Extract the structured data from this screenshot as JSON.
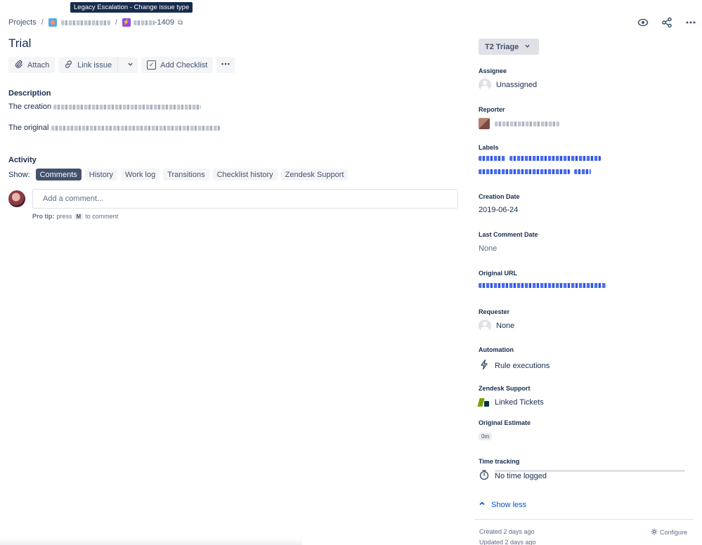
{
  "tooltip": "Legacy Escalation - Change issue type",
  "breadcrumbs": {
    "projects": "Projects",
    "sep": "/",
    "issue_key_suffix": "-1409"
  },
  "issue": {
    "title": "Trial"
  },
  "toolbar": {
    "attach": "Attach",
    "link_issue": "Link issue",
    "add_checklist": "Add Checklist"
  },
  "description": {
    "label": "Description",
    "line1_prefix": "The creation",
    "line2_prefix": "The original"
  },
  "activity": {
    "label": "Activity",
    "show_label": "Show:",
    "tabs": [
      "Comments",
      "History",
      "Work log",
      "Transitions",
      "Checklist history",
      "Zendesk Support"
    ],
    "comment_placeholder": "Add a comment...",
    "pro_tip_label": "Pro tip:",
    "pro_tip_press": "press",
    "pro_tip_key": "M",
    "pro_tip_rest": "to comment"
  },
  "sidebar": {
    "status": "T2 Triage",
    "assignee_label": "Assignee",
    "assignee_value": "Unassigned",
    "reporter_label": "Reporter",
    "labels_label": "Labels",
    "creation_date_label": "Creation Date",
    "creation_date_value": "2019-06-24",
    "last_comment_label": "Last Comment Date",
    "last_comment_value": "None",
    "original_url_label": "Original URL",
    "requester_label": "Requester",
    "requester_value": "None",
    "automation_label": "Automation",
    "automation_value": "Rule executions",
    "zendesk_label": "Zendesk Support",
    "zendesk_value": "Linked Tickets",
    "original_estimate_label": "Original Estimate",
    "original_estimate_value": "0m",
    "time_tracking_label": "Time tracking",
    "time_tracking_value": "No time logged",
    "show_less": "Show less"
  },
  "footer": {
    "created": "Created 2 days ago",
    "updated": "Updated 2 days ago",
    "configure": "Configure"
  },
  "colors": {
    "accent": "#0052cc",
    "text": "#172b4d",
    "active_tab": "#42526e"
  }
}
